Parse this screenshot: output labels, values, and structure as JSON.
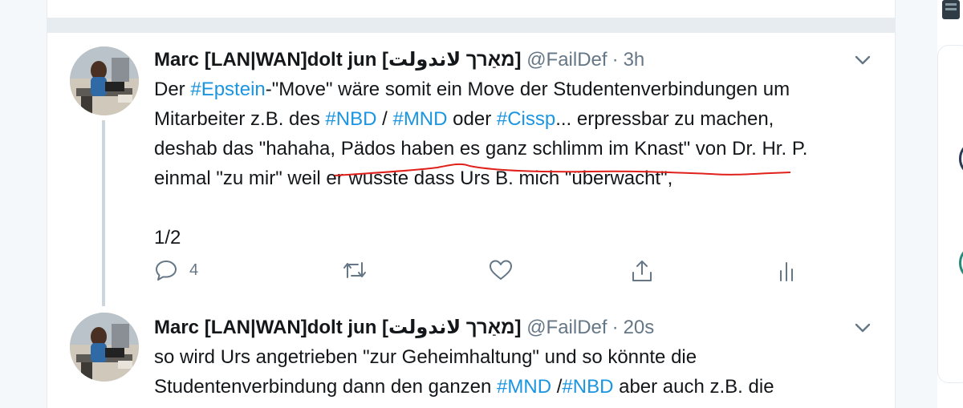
{
  "tweets": [
    {
      "name": "Marc [LAN|WAN]dolt jun [מאַרך لاندولت]",
      "handle": "@FailDef",
      "time": "3h",
      "body": {
        "l1_a": "Der ",
        "l1_tag": "#Epstein",
        "l1_b": "-\"Move\" wäre somit ein Move der Studentenverbindungen um",
        "l2_a": "Mitarbeiter z.B. des ",
        "l2_tag1": "#NBD",
        "l2_b": " / ",
        "l2_tag2": "#MND",
        "l2_c": " oder ",
        "l2_tag3": "#Cissp",
        "l2_d": "... erpressbar zu machen,",
        "l3": "deshab das \"hahaha, Pädos haben es ganz schlimm im Knast\" von Dr. Hr. P.",
        "l4": "einmal \"zu mir\" weil er wusste dass Urs B. mich \"überwacht\",",
        "l6": "1/2"
      },
      "reply_count": "4"
    },
    {
      "name": "Marc [LAN|WAN]dolt jun [מאַרך لاندولت]",
      "handle": "@FailDef",
      "time": "20s",
      "body": {
        "l1": "so wird Urs angetrieben \"zur Geheimhaltung\" und so könnte die",
        "l2_a": "Studentenverbindung dann den ganzen ",
        "l2_tag1": "#MND",
        "l2_b": " /",
        "l2_tag2": "#NBD",
        "l2_c": " aber auch z.B. die"
      }
    }
  ],
  "colors": {
    "link": "#1b95e0",
    "muted": "#657786",
    "text": "#14171a",
    "strike": "#e0201b"
  }
}
